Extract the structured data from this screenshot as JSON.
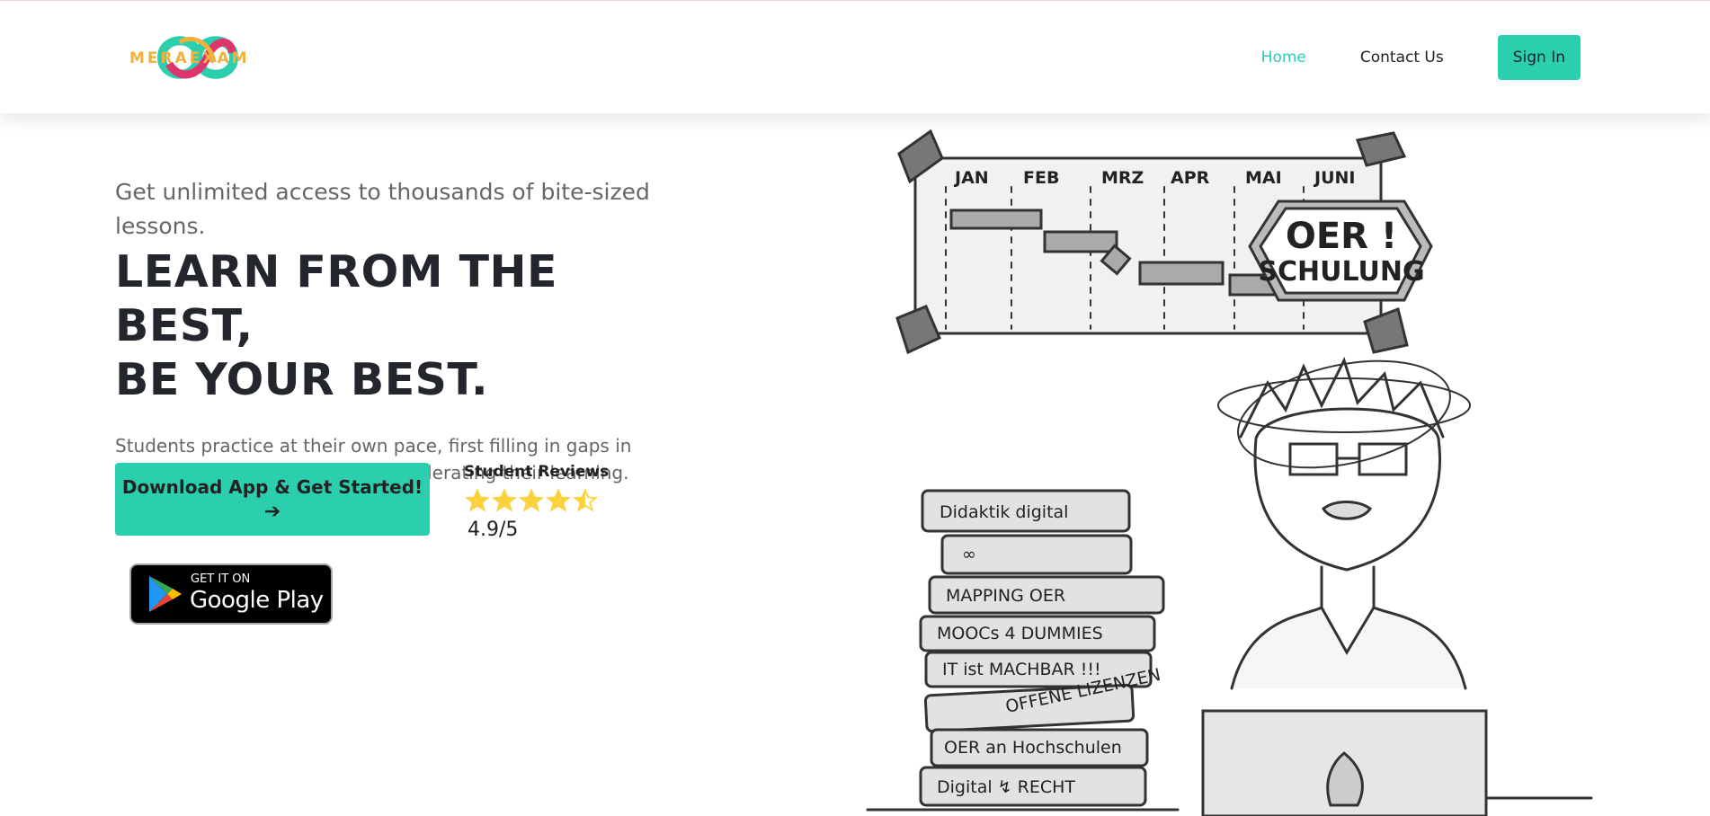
{
  "brand": {
    "logo_text": "MERAEXAM"
  },
  "nav": {
    "home": "Home",
    "contact": "Contact Us",
    "signin": "Sign In"
  },
  "hero": {
    "tagline": "Get unlimited access to thousands of bite-sized lessons.",
    "headline_line1": "LEARN FROM THE BEST,",
    "headline_line2": "BE YOUR BEST.",
    "description": "Students practice at their own pace, first filling in gaps in their understanding and then accelerating their learning.",
    "cta_label": "Download App & Get Started!",
    "cta_arrow": "➔"
  },
  "reviews": {
    "title": "Student Reviews",
    "rating_text": "4.9/5",
    "stars": 4.5
  },
  "google_play": {
    "small": "GET IT ON",
    "big": "Google Play"
  },
  "illustration": {
    "months": [
      "JAN",
      "FEB",
      "MRZ",
      "APR",
      "MAI",
      "JUNI"
    ],
    "sign_line1": "OER !",
    "sign_line2": "SCHULUNG",
    "books": [
      "Didaktik digital",
      "∞",
      "MAPPING OER",
      "MOOCs 4 DUMMIES",
      "IT ist MACHBAR !!!",
      "OFFENE LIZENZEN",
      "OER an Hochschulen",
      "Digital ↯ RECHT"
    ]
  },
  "colors": {
    "accent": "#2bcfae",
    "star": "#fbd13c",
    "text_dark": "#23262d",
    "text_muted": "#666666"
  }
}
